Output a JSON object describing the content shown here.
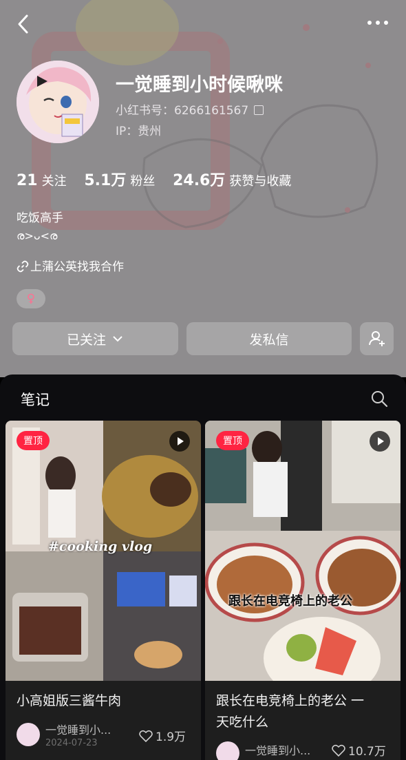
{
  "profile": {
    "nickname": "一觉睡到小时候啾咪",
    "red_id": "小红书号：6266161567",
    "ip": "IP：贵州",
    "stats": [
      {
        "num": "21",
        "label": "关注"
      },
      {
        "num": "5.1万",
        "label": "粉丝"
      },
      {
        "num": "24.6万",
        "label": "获赞与收藏"
      }
    ],
    "bio_line1": "吃饭高手",
    "bio_line2": "ര>ᴗ<ര",
    "link": "上蒲公英找我合作",
    "gender": "♀"
  },
  "actions": {
    "follow": "已关注",
    "message": "发私信"
  },
  "notes": {
    "tab_title": "笔记",
    "cards": [
      {
        "badge": "置顶",
        "cover_text": "#cooking vlog",
        "title": "小高姐版三酱牛肉",
        "author": "一觉睡到小...",
        "date": "2024-07-23",
        "likes": "1.9万"
      },
      {
        "badge": "置顶",
        "cover_text": "跟长在电竞椅上的老公",
        "title_line1": "跟长在电竞椅上的老公 一",
        "title_line2": "天吃什么",
        "author": "一觉睡到小...",
        "likes": "10.7万"
      }
    ]
  },
  "colors": {
    "accent": "#ff2442",
    "header_bg": "#8d8b8d",
    "panel_bg": "#0d0d10"
  },
  "icons": [
    "back-icon",
    "more-icon",
    "copy-icon",
    "link-icon",
    "chevron-down-icon",
    "add-friend-icon",
    "search-icon",
    "play-icon",
    "heart-icon"
  ]
}
